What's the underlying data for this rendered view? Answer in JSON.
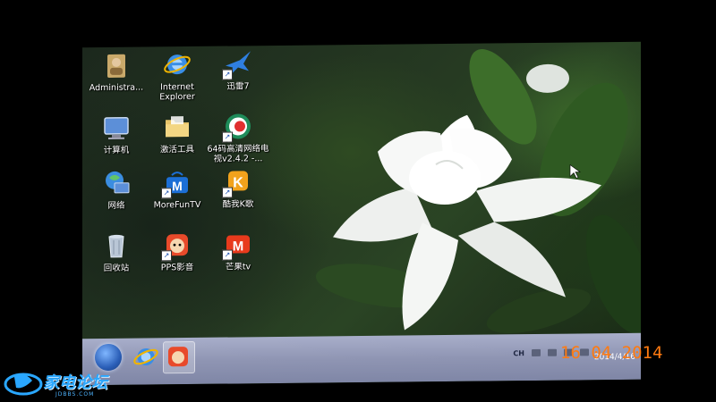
{
  "desktop": {
    "icons": [
      {
        "label": "Administra...",
        "icon": "user-folder-icon"
      },
      {
        "label": "Internet Explorer",
        "icon": "ie-icon"
      },
      {
        "label": "迅雷7",
        "icon": "thunder-bird-icon"
      },
      {
        "label": "计算机",
        "icon": "computer-icon"
      },
      {
        "label": "激活工具",
        "icon": "folder-icon"
      },
      {
        "label": "64码高清网络电视v2.4.2 -...",
        "icon": "tv-logo-icon"
      },
      {
        "label": "网络",
        "icon": "network-icon"
      },
      {
        "label": "MoreFunTV",
        "icon": "morefuntv-icon"
      },
      {
        "label": "酷我K歌",
        "icon": "kuwo-k-icon"
      },
      {
        "label": "回收站",
        "icon": "recycle-bin-icon"
      },
      {
        "label": "PPS影音",
        "icon": "pps-icon"
      },
      {
        "label": "芒果tv",
        "icon": "mango-tv-icon"
      }
    ]
  },
  "taskbar": {
    "language": "CH",
    "clock_date": "2014/4/16",
    "pinned": [
      {
        "icon": "start-orb-icon"
      },
      {
        "icon": "ie-icon"
      },
      {
        "icon": "pps-icon"
      }
    ]
  },
  "camera_date_stamp": "16 04 2014",
  "watermark": {
    "text": "家电论坛",
    "sub": "JDBBS.COM"
  },
  "colors": {
    "taskbar": "#9aa0be",
    "date_stamp": "#ff7a10",
    "watermark": "#2aa7ff"
  }
}
